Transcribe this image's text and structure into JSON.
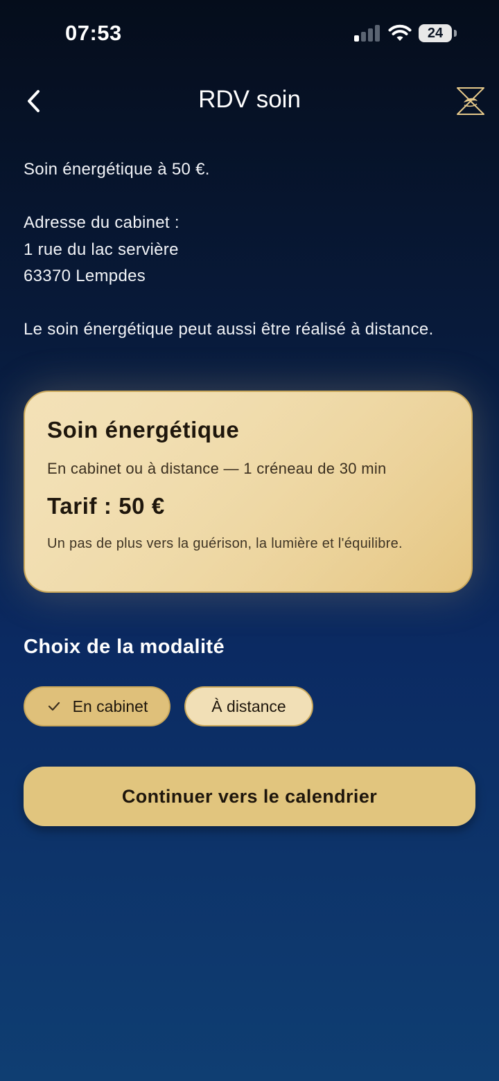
{
  "status_bar": {
    "time": "07:53",
    "battery_level": "24",
    "signal_icon": "cellular-signal-icon",
    "wifi_icon": "wifi-icon"
  },
  "header": {
    "back_icon": "chevron-left-icon",
    "title": "RDV soin",
    "logo_icon": "hourglass-star-logo"
  },
  "intro": {
    "line_price": "Soin énergétique à 50 €.",
    "address_label": "Adresse du cabinet :",
    "address_street": "1 rue du lac servière",
    "address_city": "63370 Lempdes",
    "remote_note": "Le soin énergétique peut aussi être réalisé à distance."
  },
  "offer_card": {
    "title": "Soin énergétique",
    "subtitle": "En cabinet ou à distance — 1 créneau de 30 min",
    "price": "Tarif : 50 €",
    "tagline": "Un pas de plus vers la guérison, la lumière et l'équilibre."
  },
  "modality": {
    "section_title": "Choix de la modalité",
    "options": [
      {
        "label": "En cabinet",
        "selected": true
      },
      {
        "label": "À distance",
        "selected": false
      }
    ]
  },
  "cta": {
    "label": "Continuer vers le calendrier"
  },
  "colors": {
    "background_top": "#050d1b",
    "background_bottom": "#0f3e72",
    "gold": "#e1c57e",
    "gold_light": "#f1dfb6",
    "gold_border": "#c9a75a",
    "text_dark": "#1e160c"
  }
}
